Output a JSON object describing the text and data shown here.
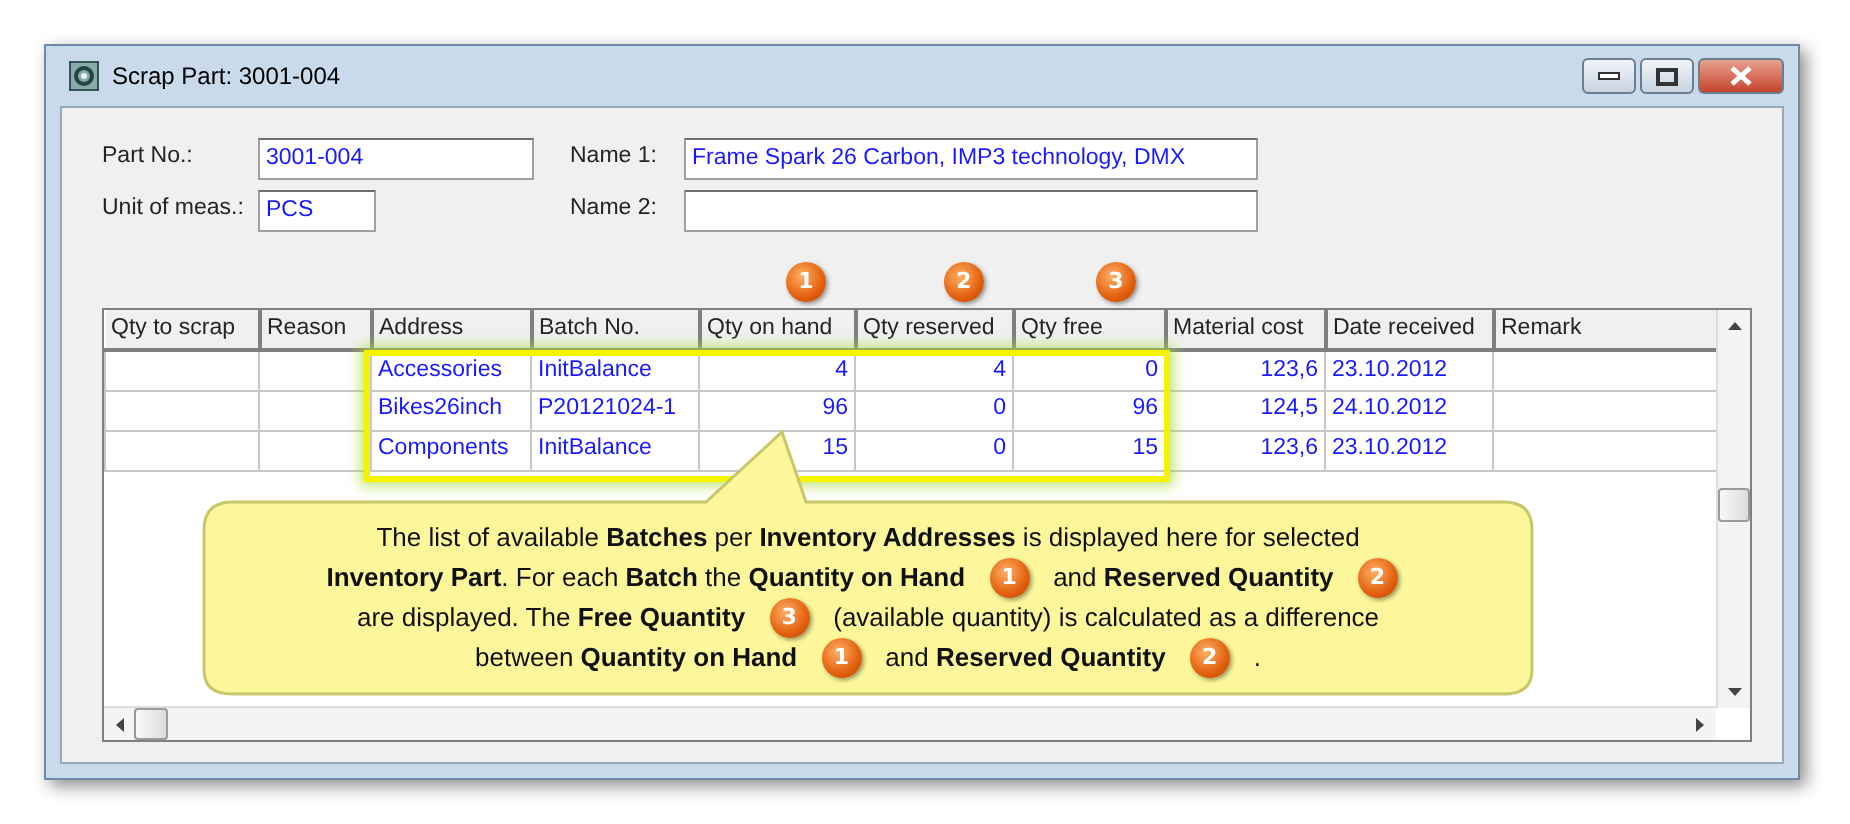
{
  "window": {
    "title": "Scrap Part: 3001-004"
  },
  "fields": [
    {
      "label": "Part No.:",
      "value": "3001-004"
    },
    {
      "label": "Name 1:",
      "value": "Frame Spark 26 Carbon, IMP3 technology, DMX"
    },
    {
      "label": "Unit of meas.:",
      "value": "PCS"
    },
    {
      "label": "Name 2:"
    }
  ],
  "table": {
    "columns": [
      {
        "label": "Qty to scrap",
        "highlighted": false
      },
      {
        "label": "Reason",
        "highlighted": false
      },
      {
        "label": "Address",
        "highlighted": true
      },
      {
        "label": "Batch No.",
        "highlighted": true
      },
      {
        "label": "Qty on hand",
        "badge": "1",
        "highlighted": true
      },
      {
        "label": "Qty reserved",
        "badge": "2",
        "highlighted": true
      },
      {
        "label": "Qty free",
        "badge": "3",
        "highlighted": true
      },
      {
        "label": "Material cost",
        "highlighted": false
      },
      {
        "label": "Date received",
        "highlighted": false
      },
      {
        "label": "Remark",
        "highlighted": false
      }
    ],
    "rows": [
      {
        "cells": [
          null,
          null,
          "Accessories",
          "InitBalance",
          "4",
          "4",
          "0",
          "123,6",
          "23.10.2012",
          null
        ]
      },
      {
        "cells": [
          null,
          null,
          "Bikes26inch",
          "P20121024-1",
          "96",
          "0",
          "96",
          "124,5",
          "24.10.2012",
          null
        ]
      },
      {
        "cells": [
          null,
          null,
          "Components",
          "InitBalance",
          "15",
          "0",
          "15",
          "123,6",
          "23.10.2012",
          null
        ]
      }
    ]
  },
  "callout": {
    "lines": [
      [
        {
          "kind": "text",
          "text": "The list of available **Batches** per **Inventory Addresses** is displayed here for selected"
        }
      ],
      [
        {
          "kind": "text",
          "text": "**Inventory Part**.  For each **Batch** the **Quantity on Hand**"
        },
        {
          "kind": "badge",
          "text": "1"
        },
        {
          "kind": "text",
          "text": "and **Reserved Quantity**"
        },
        {
          "kind": "badge",
          "text": "2"
        }
      ],
      [
        {
          "kind": "text",
          "text": "are displayed.  The **Free Quantity**"
        },
        {
          "kind": "badge",
          "text": "3"
        },
        {
          "kind": "text",
          "text": "(available quantity) is calculated as a difference"
        }
      ],
      [
        {
          "kind": "text",
          "text": "between **Quantity on Hand**"
        },
        {
          "kind": "badge",
          "text": "1"
        },
        {
          "kind": "text",
          "text": "and **Reserved Quantity**"
        },
        {
          "kind": "badge",
          "text": "2"
        },
        {
          "kind": "text",
          "text": "."
        }
      ]
    ]
  }
}
